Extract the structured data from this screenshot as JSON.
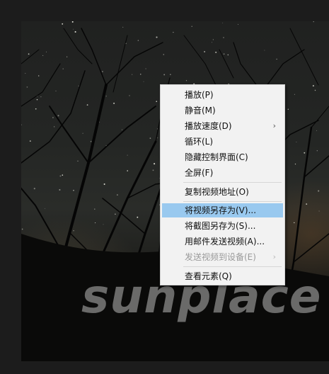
{
  "watermark": "sunplace",
  "context_menu": {
    "items": [
      {
        "label": "播放(P)"
      },
      {
        "label": "静音(M)"
      },
      {
        "label": "播放速度(D)",
        "submenu_arrow": "›"
      },
      {
        "label": "循环(L)"
      },
      {
        "label": "隐藏控制界面(C)"
      },
      {
        "label": "全屏(F)"
      },
      {
        "label": "复制视频地址(O)"
      },
      {
        "label": "将视频另存为(V)...",
        "highlighted": true
      },
      {
        "label": "将截图另存为(S)..."
      },
      {
        "label": "用邮件发送视频(A)..."
      },
      {
        "label": "发送视频到设备(E)",
        "submenu_arrow": "›",
        "disabled": true
      },
      {
        "label": "查看元素(Q)"
      }
    ]
  }
}
